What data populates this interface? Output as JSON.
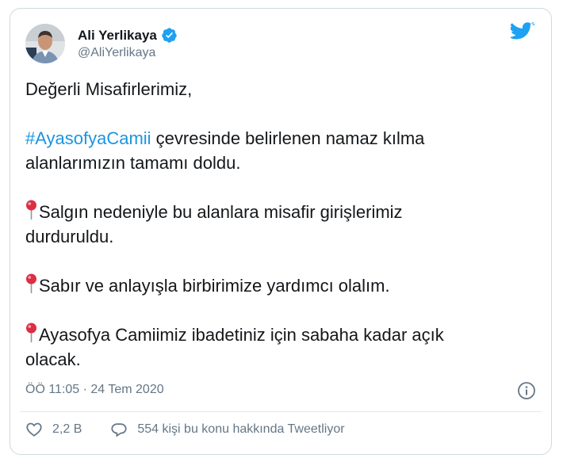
{
  "author": {
    "name": "Ali Yerlikaya",
    "handle": "@AliYerlikaya",
    "verified_icon": "verified-badge-icon"
  },
  "brand": {
    "logo": "twitter-bird-icon",
    "color": "#1da1f2"
  },
  "tweet": {
    "greeting": "Değerli Misafirlerimiz,",
    "hashtag": "#AyasofyaCamii",
    "hashtag_line_rest": " çevresinde belirlenen namaz kılma",
    "hashtag_line_2": "alanlarımızın tamamı doldu.",
    "pin_icon": "round-pushpin-icon",
    "item1_line1": "Salgın nedeniyle bu alanlara misafir girişlerimiz",
    "item1_line2": "durduruldu.",
    "item2_line1": "Sabır ve anlayışla birbirimize yardımcı olalım.",
    "item3_line1": "Ayasofya Camiimiz ibadetiniz için sabaha kadar açık",
    "item3_line2": "olacak."
  },
  "meta": {
    "timestamp": "ÖÖ 11:05 · 24 Tem 2020",
    "info_icon": "info-icon"
  },
  "actions": {
    "likes": "2,2 B",
    "conversation": "554 kişi bu konu hakkında Tweetliyor"
  },
  "colors": {
    "hashtag": "#1b95e0",
    "secondary_text": "#657786",
    "pin_red": "#dd2e44"
  }
}
